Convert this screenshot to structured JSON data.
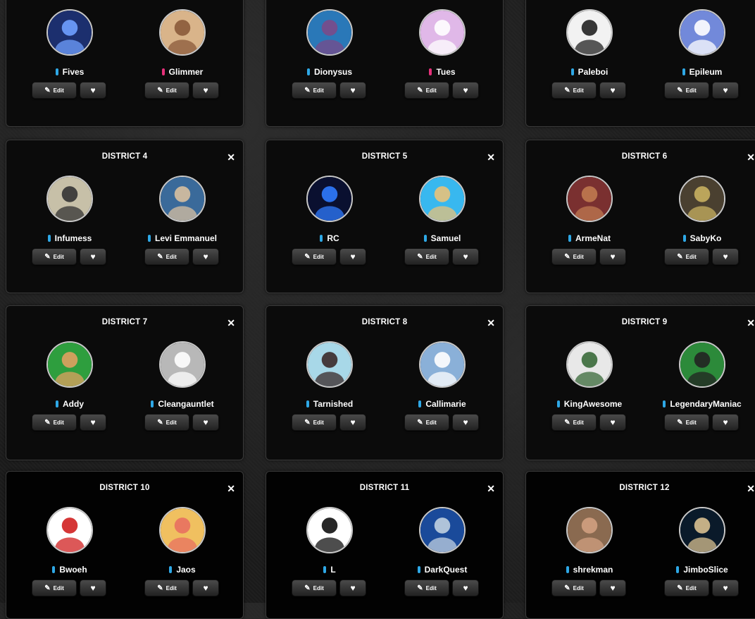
{
  "labels": {
    "edit": "Edit",
    "close": "✕"
  },
  "icons": {
    "edit": "pencil-square-icon",
    "favorite": "heart-icon",
    "close": "close-icon"
  },
  "colors": {
    "male": "#2ea8e6",
    "female": "#e6307a",
    "card": "#0b0b0b"
  },
  "districts": [
    {
      "title": "",
      "tributes": [
        {
          "name": "Fives",
          "gender": "male"
        },
        {
          "name": "Glimmer",
          "gender": "female"
        }
      ]
    },
    {
      "title": "",
      "tributes": [
        {
          "name": "Dionysus",
          "gender": "male"
        },
        {
          "name": "Tues",
          "gender": "female"
        }
      ]
    },
    {
      "title": "",
      "tributes": [
        {
          "name": "Paleboi",
          "gender": "male"
        },
        {
          "name": "Epileum",
          "gender": "male"
        }
      ]
    },
    {
      "title": "DISTRICT 4",
      "tributes": [
        {
          "name": "Infumess",
          "gender": "male"
        },
        {
          "name": "Levi Emmanuel",
          "gender": "male"
        }
      ]
    },
    {
      "title": "DISTRICT 5",
      "tributes": [
        {
          "name": "RC",
          "gender": "male"
        },
        {
          "name": "Samuel",
          "gender": "male"
        }
      ]
    },
    {
      "title": "DISTRICT 6",
      "tributes": [
        {
          "name": "ArmeNat",
          "gender": "male"
        },
        {
          "name": "SabyKo",
          "gender": "male"
        }
      ]
    },
    {
      "title": "DISTRICT 7",
      "tributes": [
        {
          "name": "Addy",
          "gender": "male"
        },
        {
          "name": "Cleangauntlet",
          "gender": "male"
        }
      ]
    },
    {
      "title": "DISTRICT 8",
      "tributes": [
        {
          "name": "Tarnished",
          "gender": "male"
        },
        {
          "name": "Callimarie",
          "gender": "male"
        }
      ]
    },
    {
      "title": "DISTRICT 9",
      "tributes": [
        {
          "name": "KingAwesome",
          "gender": "male"
        },
        {
          "name": "LegendaryManiac",
          "gender": "male"
        }
      ]
    },
    {
      "title": "DISTRICT 10",
      "tributes": [
        {
          "name": "Bwoeh",
          "gender": "male"
        },
        {
          "name": "Jaos",
          "gender": "male"
        }
      ]
    },
    {
      "title": "DISTRICT 11",
      "tributes": [
        {
          "name": "L",
          "gender": "male"
        },
        {
          "name": "DarkQuest",
          "gender": "male"
        }
      ]
    },
    {
      "title": "DISTRICT 12",
      "tributes": [
        {
          "name": "shrekman",
          "gender": "male"
        },
        {
          "name": "JimboSlice",
          "gender": "male"
        }
      ]
    }
  ]
}
